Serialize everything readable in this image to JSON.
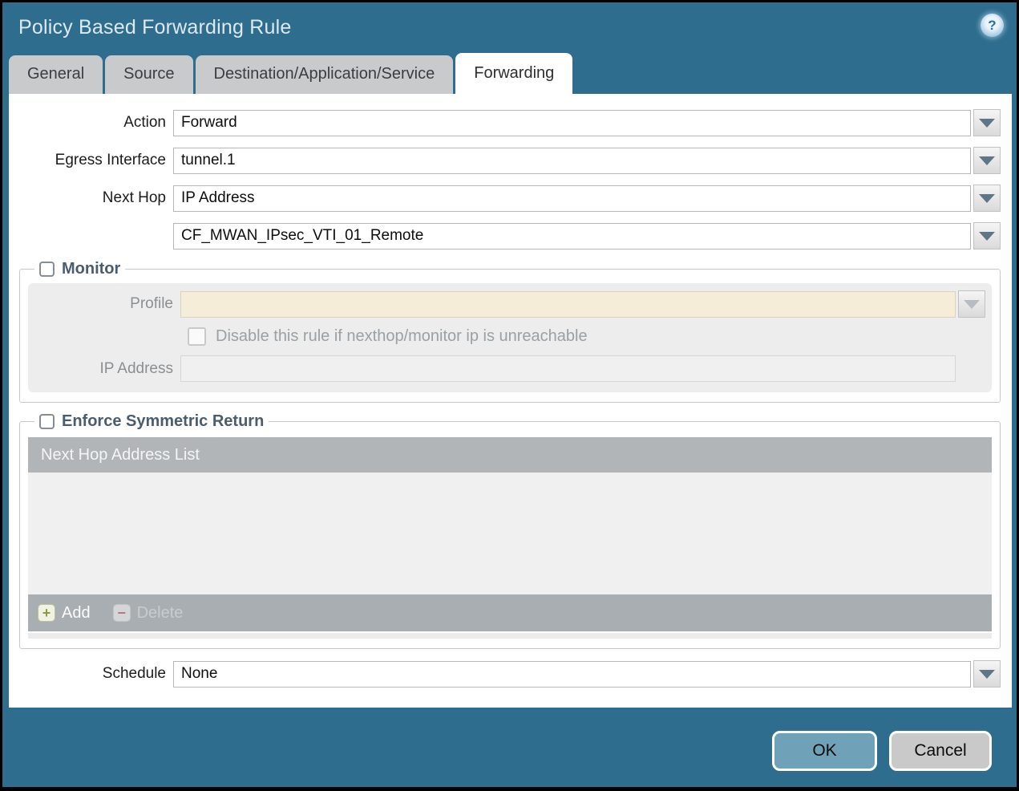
{
  "window": {
    "title": "Policy Based Forwarding Rule"
  },
  "tabs": [
    {
      "label": "General",
      "active": false
    },
    {
      "label": "Source",
      "active": false
    },
    {
      "label": "Destination/Application/Service",
      "active": false
    },
    {
      "label": "Forwarding",
      "active": true
    }
  ],
  "form": {
    "action": {
      "label": "Action",
      "value": "Forward"
    },
    "egress_interface": {
      "label": "Egress Interface",
      "value": "tunnel.1"
    },
    "next_hop": {
      "label": "Next Hop",
      "value": "IP Address"
    },
    "next_hop_address": {
      "value": "CF_MWAN_IPsec_VTI_01_Remote"
    },
    "schedule": {
      "label": "Schedule",
      "value": "None"
    }
  },
  "monitor": {
    "label": "Monitor",
    "checked": false,
    "profile": {
      "label": "Profile",
      "value": ""
    },
    "disable_rule": {
      "label": "Disable this rule if nexthop/monitor ip is unreachable",
      "checked": false
    },
    "ip_address": {
      "label": "IP Address",
      "value": ""
    }
  },
  "enforce": {
    "label": "Enforce Symmetric Return",
    "checked": false,
    "table": {
      "header": "Next Hop Address List",
      "rows": []
    },
    "add_label": "Add",
    "delete_label": "Delete",
    "add_icon_glyph": "+",
    "delete_icon_glyph": "−"
  },
  "footer": {
    "ok": "OK",
    "cancel": "Cancel"
  },
  "icons": {
    "help": "?"
  },
  "colors": {
    "titlebar": "#2e6d8d",
    "tab_inactive": "#c9cacb",
    "tab_active": "#ffffff",
    "profile_field": "#f6edd8",
    "table_header": "#b1b5b8",
    "table_footer": "#a9aeb3",
    "add_green": "#8a9b3f",
    "delete_red": "#b7767c",
    "ok_button": "#6fa2b8",
    "cancel_button": "#c9c9c9"
  }
}
